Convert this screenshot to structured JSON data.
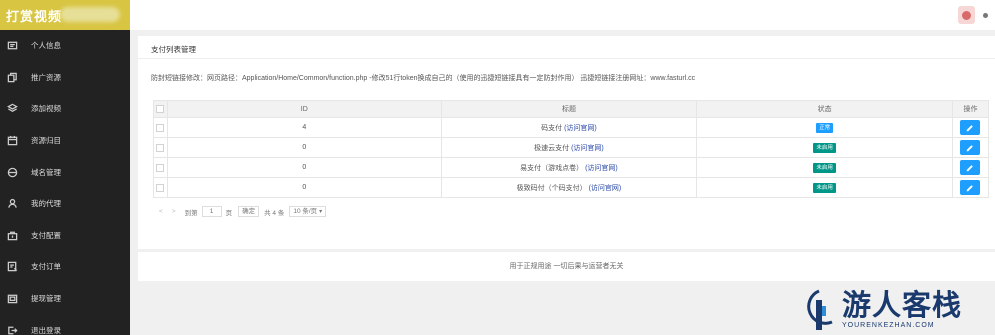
{
  "brand": {
    "title": "打赏视频"
  },
  "sidebar": {
    "items": [
      {
        "label": "个人信息",
        "icon": "id-card-icon"
      },
      {
        "label": "推广资源",
        "icon": "copy-icon"
      },
      {
        "label": "添加视频",
        "icon": "layers-icon"
      },
      {
        "label": "资源归目",
        "icon": "calendar-icon"
      },
      {
        "label": "域名管理",
        "icon": "globe-icon"
      },
      {
        "label": "我的代理",
        "icon": "user-icon"
      },
      {
        "label": "支付配置",
        "icon": "bag-icon"
      },
      {
        "label": "支付订单",
        "icon": "order-icon"
      },
      {
        "label": "提现管理",
        "icon": "wallet-icon"
      },
      {
        "label": "退出登录",
        "icon": "logout-icon"
      }
    ]
  },
  "panel": {
    "title": "支付列表管理",
    "notice": "防封短链接修改：网页路径：Application/Home/Common/function.php -修改51行token换成自己的（使用的迅捷短链接具有一定防封作用） 迅捷短链接注册网址：www.fasturl.cc"
  },
  "table": {
    "headers": {
      "id": "ID",
      "title": "标题",
      "status": "状态",
      "op": "操作"
    },
    "link_text": "(访问官网)",
    "rows": [
      {
        "id": "4",
        "name": "码支付",
        "status": "正常",
        "status_type": "on"
      },
      {
        "id": "0",
        "name": "极速云支付",
        "status": "未启用",
        "status_type": "off"
      },
      {
        "id": "0",
        "name": "易支付（游戏点卷）",
        "status": "未启用",
        "status_type": "off"
      },
      {
        "id": "0",
        "name": "极致码付（个码支付）",
        "status": "未启用",
        "status_type": "off"
      }
    ]
  },
  "pager": {
    "prev": "<",
    "next": ">",
    "goto_label": "到第",
    "page_value": "1",
    "page_unit": "页",
    "confirm": "确定",
    "total": "共 4 条",
    "per_page": "10 条/页"
  },
  "footer": {
    "text": "用于正规用途 一切后果与运营者无关"
  },
  "watermark": {
    "cn": "游人客栈",
    "en": "YOURENKEZHAN.COM"
  },
  "colors": {
    "brand": "#d8c542",
    "sidebar": "#222222",
    "accent": "#1e9fff",
    "disabled": "#009688"
  }
}
